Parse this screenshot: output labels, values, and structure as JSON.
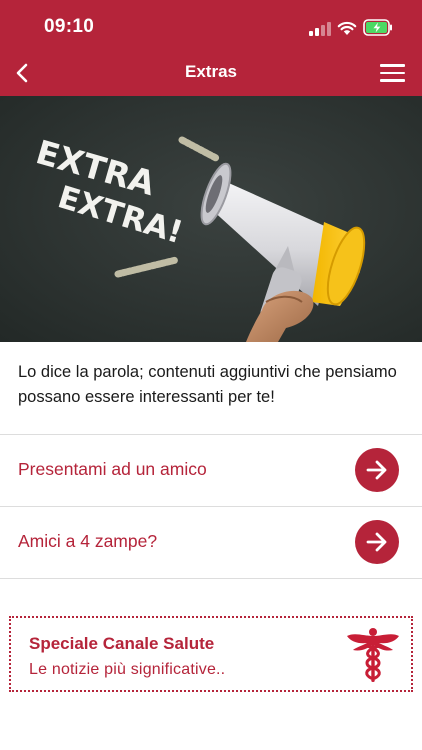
{
  "status_bar": {
    "time": "09:10"
  },
  "header": {
    "title": "Extras"
  },
  "hero": {
    "headline_line1": "EXTRA",
    "headline_line2": "EXTRA!"
  },
  "intro": {
    "text": "Lo dice la parola; contenuti aggiuntivi che pensiamo possano essere interessanti per te!"
  },
  "items": [
    {
      "label": "Presentami ad un amico"
    },
    {
      "label": "Amici a 4 zampe?"
    }
  ],
  "promo": {
    "title": "Speciale Canale Salute",
    "subtitle": "Le notizie più significative.."
  },
  "colors": {
    "brand": "#b5243a",
    "chalkboard": "#2e3433",
    "divider": "#dddddd"
  },
  "icons": [
    "back-chevron-icon",
    "hamburger-menu-icon",
    "arrow-right-icon",
    "caduceus-icon",
    "signal-icon",
    "wifi-icon",
    "battery-charging-icon"
  ]
}
